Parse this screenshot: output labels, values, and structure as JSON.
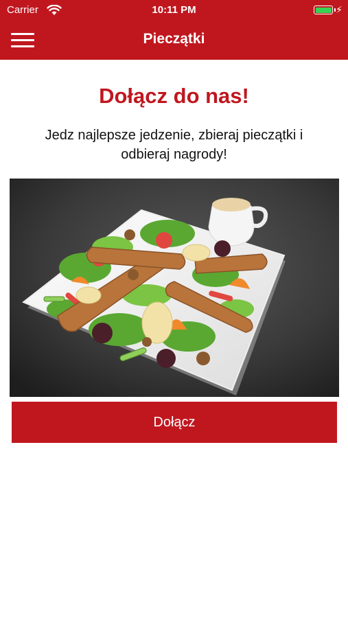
{
  "status_bar": {
    "carrier": "Carrier",
    "time": "10:11 PM",
    "battery_color": "#39d353"
  },
  "nav": {
    "title": "Pieczątki",
    "menu_icon": "hamburger-icon"
  },
  "content": {
    "heading": "Dołącz do nas!",
    "subtitle": "Jedz najlepsze jedzenie, zbieraj pieczątki i odbieraj nagrody!",
    "image_subject": "salad-plate-image",
    "button_label": "Dołącz"
  },
  "colors": {
    "brand": "#c0171f",
    "text": "#111111",
    "background": "#ffffff"
  }
}
